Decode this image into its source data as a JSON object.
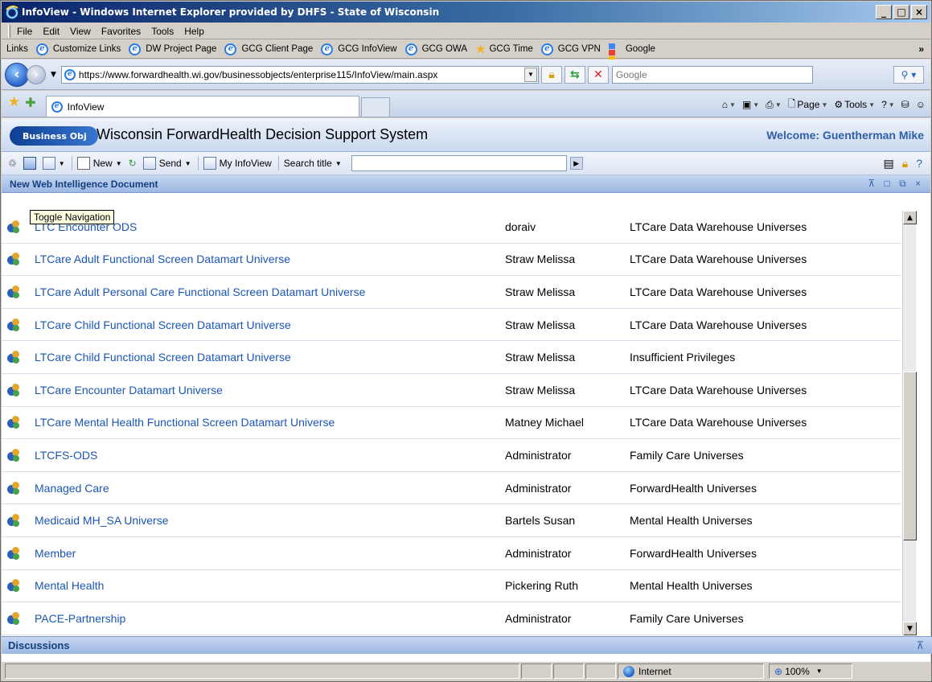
{
  "window": {
    "title": "InfoView - Windows Internet Explorer provided by DHFS - State of Wisconsin",
    "minimize": "_",
    "maximize": "□",
    "close": "×"
  },
  "menu": [
    "File",
    "Edit",
    "View",
    "Favorites",
    "Tools",
    "Help"
  ],
  "links_bar": {
    "label": "Links",
    "items": [
      "Customize Links",
      "DW Project Page",
      "GCG Client Page",
      "GCG InfoView",
      "GCG OWA",
      "GCG Time",
      "GCG VPN",
      "Google"
    ],
    "more": "»"
  },
  "address": {
    "url": "https://www.forwardhealth.wi.gov/businessobjects/enterprise115/InfoView/main.aspx",
    "search_placeholder": "Google"
  },
  "tabs": {
    "active": "InfoView"
  },
  "commandbar": {
    "page": "Page",
    "tools": "Tools"
  },
  "app": {
    "logo_text": "Business Obj",
    "system_title": "Wisconsin ForwardHealth Decision Support System",
    "welcome": "Welcome: Guentherman Mike"
  },
  "toolbar": {
    "new_label": "New",
    "send_label": "Send",
    "myinfoview_label": "My InfoView",
    "search_title_label": "Search title"
  },
  "tooltip": "Toggle Navigation",
  "panel": {
    "title": "New Web Intelligence Document",
    "controls": "⊼ □ ⧉ ×"
  },
  "rows": [
    {
      "name": "LTC Encounter ODS",
      "owner": "doraiv",
      "folder": "LTCare Data Warehouse Universes"
    },
    {
      "name": "LTCare Adult Functional Screen Datamart Universe",
      "owner": "Straw Melissa",
      "folder": "LTCare Data Warehouse Universes"
    },
    {
      "name": "LTCare Adult Personal Care Functional Screen Datamart Universe",
      "owner": "Straw Melissa",
      "folder": "LTCare Data Warehouse Universes"
    },
    {
      "name": "LTCare Child Functional Screen Datamart Universe",
      "owner": "Straw Melissa",
      "folder": "LTCare Data Warehouse Universes"
    },
    {
      "name": "LTCare Child Functional Screen Datamart Universe",
      "owner": "Straw Melissa",
      "folder": "Insufficient Privileges"
    },
    {
      "name": "LTCare Encounter Datamart Universe",
      "owner": "Straw Melissa",
      "folder": "LTCare Data Warehouse Universes"
    },
    {
      "name": "LTCare Mental Health Functional Screen Datamart Universe",
      "owner": "Matney Michael",
      "folder": "LTCare Data Warehouse Universes"
    },
    {
      "name": "LTCFS-ODS",
      "owner": "Administrator",
      "folder": "Family Care Universes"
    },
    {
      "name": "Managed Care",
      "owner": "Administrator",
      "folder": "ForwardHealth Universes"
    },
    {
      "name": "Medicaid MH_SA Universe",
      "owner": "Bartels Susan",
      "folder": "Mental Health Universes"
    },
    {
      "name": "Member",
      "owner": "Administrator",
      "folder": "ForwardHealth Universes"
    },
    {
      "name": "Mental Health",
      "owner": "Pickering Ruth",
      "folder": "Mental Health Universes"
    },
    {
      "name": "PACE-Partnership",
      "owner": "Administrator",
      "folder": "Family Care Universes"
    }
  ],
  "discussions": "Discussions",
  "status": {
    "zone": "Internet",
    "zoom": "100%"
  },
  "colors": {
    "link": "#1b56b5",
    "panel_header": "#9cb7e2",
    "welcome": "#2f5fa8"
  }
}
